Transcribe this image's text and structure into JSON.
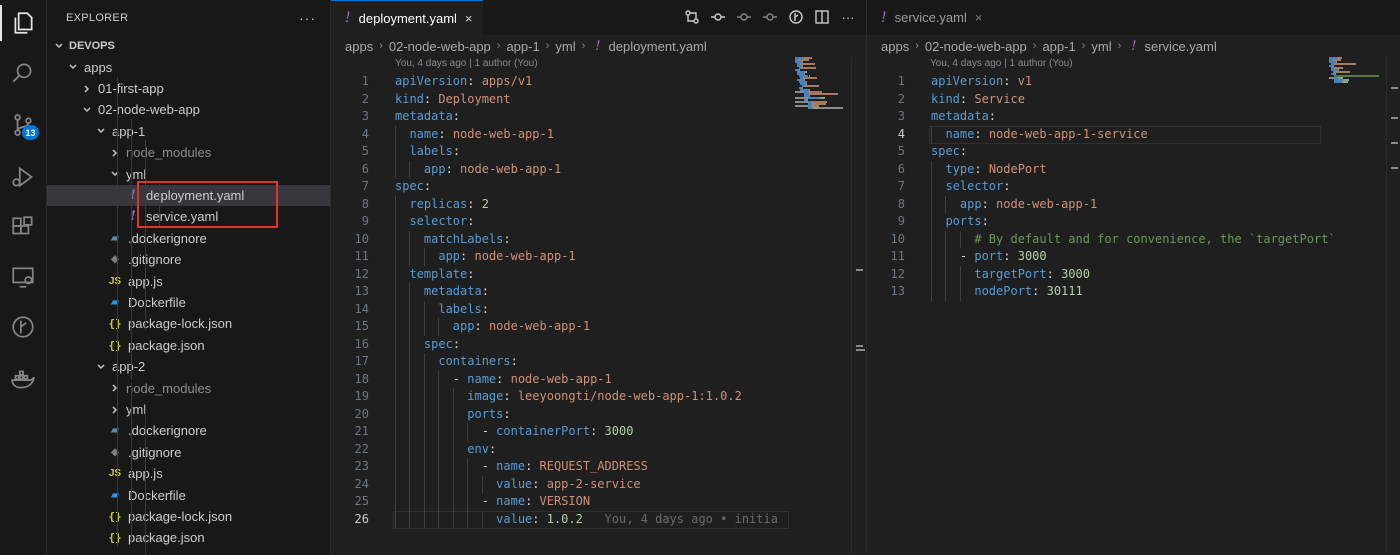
{
  "activity_bar": {
    "items": [
      "explorer-icon",
      "search-icon",
      "source-control-icon",
      "run-debug-icon",
      "extensions-icon",
      "remote-explorer-icon",
      "git-graph-icon",
      "docker-icon"
    ],
    "source_control_badge": "13"
  },
  "explorer": {
    "title": "EXPLORER",
    "more": "···",
    "root": "DEVOPS",
    "tree": [
      {
        "label": "apps",
        "depth": 1,
        "type": "folder-open"
      },
      {
        "label": "01-first-app",
        "depth": 2,
        "type": "folder-closed"
      },
      {
        "label": "02-node-web-app",
        "depth": 2,
        "type": "folder-open"
      },
      {
        "label": "app-1",
        "depth": 3,
        "type": "folder-open"
      },
      {
        "label": "node_modules",
        "depth": 4,
        "type": "folder-closed",
        "dim": true
      },
      {
        "label": "yml",
        "depth": 4,
        "type": "folder-open"
      },
      {
        "label": "deployment.yaml",
        "depth": 5,
        "type": "yaml",
        "selected": true
      },
      {
        "label": "service.yaml",
        "depth": 5,
        "type": "yaml"
      },
      {
        "label": ".dockerignore",
        "depth": 4,
        "type": "dockerignore"
      },
      {
        "label": ".gitignore",
        "depth": 4,
        "type": "gitignore"
      },
      {
        "label": "app.js",
        "depth": 4,
        "type": "js"
      },
      {
        "label": "Dockerfile",
        "depth": 4,
        "type": "docker"
      },
      {
        "label": "package-lock.json",
        "depth": 4,
        "type": "json"
      },
      {
        "label": "package.json",
        "depth": 4,
        "type": "json"
      },
      {
        "label": "app-2",
        "depth": 3,
        "type": "folder-open"
      },
      {
        "label": "node_modules",
        "depth": 4,
        "type": "folder-closed",
        "dim": true
      },
      {
        "label": "yml",
        "depth": 4,
        "type": "folder-closed"
      },
      {
        "label": ".dockerignore",
        "depth": 4,
        "type": "dockerignore"
      },
      {
        "label": ".gitignore",
        "depth": 4,
        "type": "gitignore"
      },
      {
        "label": "app.js",
        "depth": 4,
        "type": "js"
      },
      {
        "label": "Dockerfile",
        "depth": 4,
        "type": "docker"
      },
      {
        "label": "package-lock.json",
        "depth": 4,
        "type": "json"
      },
      {
        "label": "package.json",
        "depth": 4,
        "type": "json"
      }
    ]
  },
  "editor_left": {
    "tab_label": "deployment.yaml",
    "tab_close": "×",
    "breadcrumb": [
      "apps",
      "02-node-web-app",
      "app-1",
      "yml",
      "deployment.yaml"
    ],
    "codelens": "You, 4 days ago | 1 author (You)",
    "current_line": 26,
    "lines": [
      [
        [
          "k",
          "apiVersion"
        ],
        [
          "p",
          ": "
        ],
        [
          "v",
          "apps/v1"
        ]
      ],
      [
        [
          "k",
          "kind"
        ],
        [
          "p",
          ": "
        ],
        [
          "v",
          "Deployment"
        ]
      ],
      [
        [
          "k",
          "metadata"
        ],
        [
          "p",
          ":"
        ]
      ],
      [
        [
          "p",
          "  "
        ],
        [
          "k",
          "name"
        ],
        [
          "p",
          ": "
        ],
        [
          "v",
          "node-web-app-1"
        ]
      ],
      [
        [
          "p",
          "  "
        ],
        [
          "k",
          "labels"
        ],
        [
          "p",
          ":"
        ]
      ],
      [
        [
          "p",
          "    "
        ],
        [
          "k",
          "app"
        ],
        [
          "p",
          ": "
        ],
        [
          "v",
          "node-web-app-1"
        ]
      ],
      [
        [
          "k",
          "spec"
        ],
        [
          "p",
          ":"
        ]
      ],
      [
        [
          "p",
          "  "
        ],
        [
          "k",
          "replicas"
        ],
        [
          "p",
          ": "
        ],
        [
          "n",
          "2"
        ]
      ],
      [
        [
          "p",
          "  "
        ],
        [
          "k",
          "selector"
        ],
        [
          "p",
          ":"
        ]
      ],
      [
        [
          "p",
          "    "
        ],
        [
          "k",
          "matchLabels"
        ],
        [
          "p",
          ":"
        ]
      ],
      [
        [
          "p",
          "      "
        ],
        [
          "k",
          "app"
        ],
        [
          "p",
          ": "
        ],
        [
          "v",
          "node-web-app-1"
        ]
      ],
      [
        [
          "p",
          "  "
        ],
        [
          "k",
          "template"
        ],
        [
          "p",
          ":"
        ]
      ],
      [
        [
          "p",
          "    "
        ],
        [
          "k",
          "metadata"
        ],
        [
          "p",
          ":"
        ]
      ],
      [
        [
          "p",
          "      "
        ],
        [
          "k",
          "labels"
        ],
        [
          "p",
          ":"
        ]
      ],
      [
        [
          "p",
          "        "
        ],
        [
          "k",
          "app"
        ],
        [
          "p",
          ": "
        ],
        [
          "v",
          "node-web-app-1"
        ]
      ],
      [
        [
          "p",
          "    "
        ],
        [
          "k",
          "spec"
        ],
        [
          "p",
          ":"
        ]
      ],
      [
        [
          "p",
          "      "
        ],
        [
          "k",
          "containers"
        ],
        [
          "p",
          ":"
        ]
      ],
      [
        [
          "p",
          "        - "
        ],
        [
          "k",
          "name"
        ],
        [
          "p",
          ": "
        ],
        [
          "v",
          "node-web-app-1"
        ]
      ],
      [
        [
          "p",
          "          "
        ],
        [
          "k",
          "image"
        ],
        [
          "p",
          ": "
        ],
        [
          "v",
          "leeyoongti/node-web-app-1:1.0.2"
        ]
      ],
      [
        [
          "p",
          "          "
        ],
        [
          "k",
          "ports"
        ],
        [
          "p",
          ":"
        ]
      ],
      [
        [
          "p",
          "            - "
        ],
        [
          "k",
          "containerPort"
        ],
        [
          "p",
          ": "
        ],
        [
          "n",
          "3000"
        ]
      ],
      [
        [
          "p",
          "          "
        ],
        [
          "k",
          "env"
        ],
        [
          "p",
          ":"
        ]
      ],
      [
        [
          "p",
          "            - "
        ],
        [
          "k",
          "name"
        ],
        [
          "p",
          ": "
        ],
        [
          "v",
          "REQUEST_ADDRESS"
        ]
      ],
      [
        [
          "p",
          "              "
        ],
        [
          "k",
          "value"
        ],
        [
          "p",
          ": "
        ],
        [
          "v",
          "app-2-service"
        ]
      ],
      [
        [
          "p",
          "            - "
        ],
        [
          "k",
          "name"
        ],
        [
          "p",
          ": "
        ],
        [
          "v",
          "VERSION"
        ]
      ],
      [
        [
          "p",
          "              "
        ],
        [
          "k",
          "value"
        ],
        [
          "p",
          ": "
        ],
        [
          "n",
          "1.0.2"
        ],
        [
          "ghost",
          "   You, 4 days ago • initia"
        ]
      ]
    ]
  },
  "editor_right": {
    "tab_label": "service.yaml",
    "tab_close": "×",
    "breadcrumb": [
      "apps",
      "02-node-web-app",
      "app-1",
      "yml",
      "service.yaml"
    ],
    "codelens": "You, 4 days ago | 1 author (You)",
    "current_line": 4,
    "lines": [
      [
        [
          "k",
          "apiVersion"
        ],
        [
          "p",
          ": "
        ],
        [
          "v",
          "v1"
        ]
      ],
      [
        [
          "k",
          "kind"
        ],
        [
          "p",
          ": "
        ],
        [
          "v",
          "Service"
        ]
      ],
      [
        [
          "k",
          "metadata"
        ],
        [
          "p",
          ":"
        ]
      ],
      [
        [
          "p",
          "  "
        ],
        [
          "k",
          "name"
        ],
        [
          "p",
          ": "
        ],
        [
          "v",
          "node-web-app-1-service"
        ]
      ],
      [
        [
          "k",
          "spec"
        ],
        [
          "p",
          ":"
        ]
      ],
      [
        [
          "p",
          "  "
        ],
        [
          "k",
          "type"
        ],
        [
          "p",
          ": "
        ],
        [
          "v",
          "NodePort"
        ]
      ],
      [
        [
          "p",
          "  "
        ],
        [
          "k",
          "selector"
        ],
        [
          "p",
          ":"
        ]
      ],
      [
        [
          "p",
          "    "
        ],
        [
          "k",
          "app"
        ],
        [
          "p",
          ": "
        ],
        [
          "v",
          "node-web-app-1"
        ]
      ],
      [
        [
          "p",
          "  "
        ],
        [
          "k",
          "ports"
        ],
        [
          "p",
          ":"
        ]
      ],
      [
        [
          "p",
          "      "
        ],
        [
          "c",
          "# By default and for convenience, the `targetPort`"
        ]
      ],
      [
        [
          "p",
          "    - "
        ],
        [
          "k",
          "port"
        ],
        [
          "p",
          ": "
        ],
        [
          "n",
          "3000"
        ]
      ],
      [
        [
          "p",
          "      "
        ],
        [
          "k",
          "targetPort"
        ],
        [
          "p",
          ": "
        ],
        [
          "n",
          "3000"
        ]
      ],
      [
        [
          "p",
          "      "
        ],
        [
          "k",
          "nodePort"
        ],
        [
          "p",
          ": "
        ],
        [
          "n",
          "30111"
        ]
      ]
    ]
  }
}
